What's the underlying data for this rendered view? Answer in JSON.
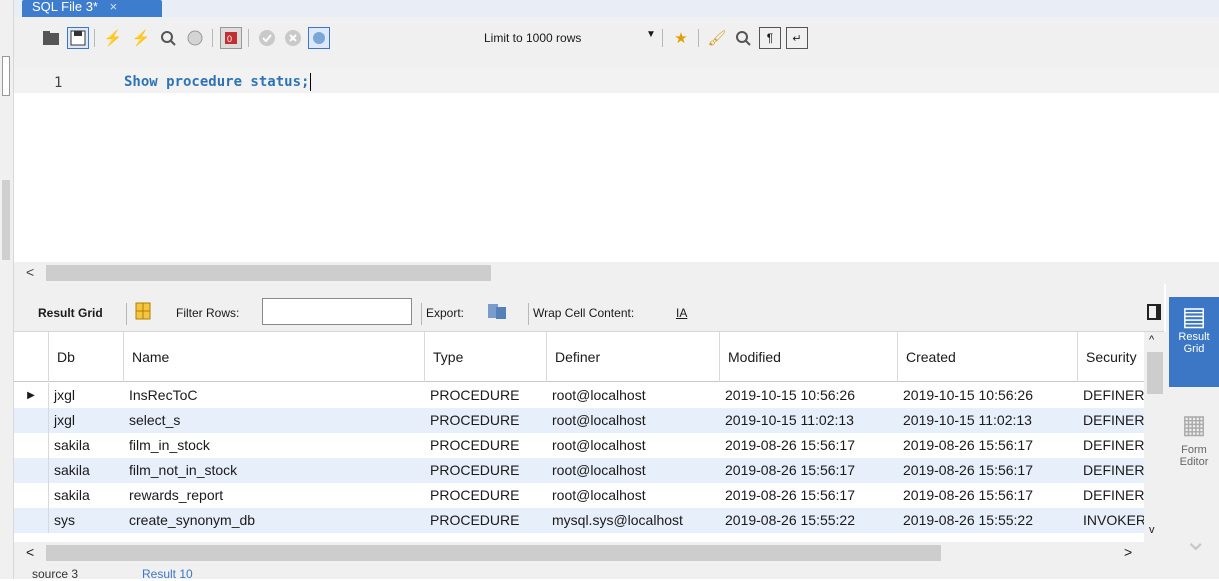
{
  "tab": {
    "title": "SQL File 3*",
    "close": "×"
  },
  "toolbar": {
    "limit_label": "Limit to 1000 rows",
    "icons": [
      "open-folder-icon",
      "save-icon",
      "execute-icon",
      "execute-current-icon",
      "explain-icon",
      "stop-icon",
      "toggle-error-icon",
      "commit-icon",
      "rollback-icon",
      "autocommit-icon",
      "limit-dropdown-icon",
      "favorite-icon",
      "beautify-icon",
      "find-icon",
      "invisible-chars-icon",
      "wrap-icon"
    ]
  },
  "editor": {
    "line_number": "1",
    "code": "Show procedure status;"
  },
  "result_bar": {
    "result_grid_label": "Result Grid",
    "filter_label": "Filter Rows:",
    "filter_value": "",
    "export_label": "Export:",
    "wrap_label": "Wrap Cell Content:"
  },
  "grid": {
    "columns": [
      "Db",
      "Name",
      "Type",
      "Definer",
      "Modified",
      "Created",
      "Security"
    ],
    "rows": [
      [
        "jxgl",
        "InsRecToC",
        "PROCEDURE",
        "root@localhost",
        "2019-10-15 10:56:26",
        "2019-10-15 10:56:26",
        "DEFINER"
      ],
      [
        "jxgl",
        "select_s",
        "PROCEDURE",
        "root@localhost",
        "2019-10-15 11:02:13",
        "2019-10-15 11:02:13",
        "DEFINER"
      ],
      [
        "sakila",
        "film_in_stock",
        "PROCEDURE",
        "root@localhost",
        "2019-08-26 15:56:17",
        "2019-08-26 15:56:17",
        "DEFINER"
      ],
      [
        "sakila",
        "film_not_in_stock",
        "PROCEDURE",
        "root@localhost",
        "2019-08-26 15:56:17",
        "2019-08-26 15:56:17",
        "DEFINER"
      ],
      [
        "sakila",
        "rewards_report",
        "PROCEDURE",
        "root@localhost",
        "2019-08-26 15:56:17",
        "2019-08-26 15:56:17",
        "DEFINER"
      ],
      [
        "sys",
        "create_synonym_db",
        "PROCEDURE",
        "mysql.sys@localhost",
        "2019-08-26 15:55:22",
        "2019-08-26 15:55:22",
        "INVOKER"
      ]
    ]
  },
  "side_panel": {
    "active_label": "Result Grid",
    "second_label": "Form Editor"
  },
  "bottom_tabs": [
    "source 3",
    "Result 10"
  ],
  "colors": {
    "accent": "#3b77c4",
    "row_alt": "#e7effa",
    "code": "#2f73b7"
  }
}
